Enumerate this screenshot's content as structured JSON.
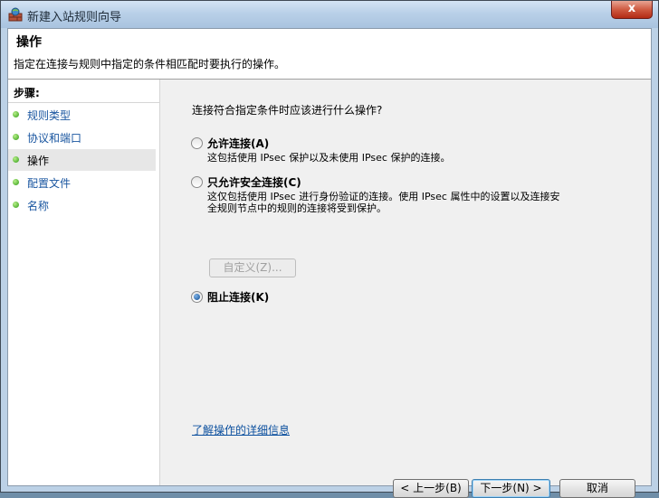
{
  "window": {
    "title": "新建入站规则向导",
    "close_label": "x"
  },
  "header": {
    "title": "操作",
    "description": "指定在连接与规则中指定的条件相匹配时要执行的操作。"
  },
  "sidebar": {
    "steps_label": "步骤:",
    "items": [
      {
        "label": "规则类型",
        "active": false
      },
      {
        "label": "协议和端口",
        "active": false
      },
      {
        "label": "操作",
        "active": true
      },
      {
        "label": "配置文件",
        "active": false
      },
      {
        "label": "名称",
        "active": false
      }
    ]
  },
  "main": {
    "question": "连接符合指定条件时应该进行什么操作?",
    "options": [
      {
        "label": "允许连接(A)",
        "desc": "这包括使用 IPsec 保护以及未使用 IPsec 保护的连接。",
        "checked": false
      },
      {
        "label": "只允许安全连接(C)",
        "desc_line1": "这仅包括使用 IPsec 进行身份验证的连接。使用 IPsec 属性中的设置以及连接安",
        "desc_line2": "全规则节点中的规则的连接将受到保护。",
        "checked": false
      },
      {
        "label": "阻止连接(K)",
        "checked": true
      }
    ],
    "customize_label": "自定义(Z)...",
    "learn_more_link": "了解操作的详细信息"
  },
  "footer": {
    "back_label": "< 上一步(B)",
    "next_label": "下一步(N) >",
    "cancel_label": "取消"
  }
}
